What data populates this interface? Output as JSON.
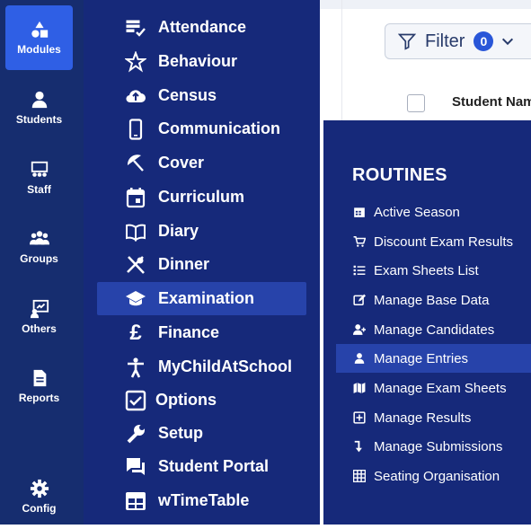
{
  "rail": {
    "items": [
      {
        "label": "Modules",
        "icon": "modules-icon"
      },
      {
        "label": "Students",
        "icon": "user-icon"
      },
      {
        "label": "Staff",
        "icon": "staff-icon"
      },
      {
        "label": "Groups",
        "icon": "groups-icon"
      },
      {
        "label": "Others",
        "icon": "others-icon"
      },
      {
        "label": "Reports",
        "icon": "report-icon"
      },
      {
        "label": "Config",
        "icon": "gear-icon"
      }
    ]
  },
  "menu": {
    "items": [
      {
        "label": "Attendance"
      },
      {
        "label": "Behaviour"
      },
      {
        "label": "Census"
      },
      {
        "label": "Communication"
      },
      {
        "label": "Cover"
      },
      {
        "label": "Curriculum"
      },
      {
        "label": "Diary"
      },
      {
        "label": "Dinner"
      },
      {
        "label": "Examination"
      },
      {
        "label": "Finance"
      },
      {
        "label": "MyChildAtSchool"
      },
      {
        "label": "Options"
      },
      {
        "label": "Setup"
      },
      {
        "label": "Student Portal"
      },
      {
        "label": "wTimeTable"
      }
    ]
  },
  "content": {
    "filter_label": "Filter",
    "filter_count": "0",
    "column_header": "Student Nam"
  },
  "popup": {
    "title": "ROUTINES",
    "items": [
      {
        "label": "Active Season"
      },
      {
        "label": "Discount Exam Results"
      },
      {
        "label": "Exam Sheets List"
      },
      {
        "label": "Manage Base Data"
      },
      {
        "label": "Manage Candidates"
      },
      {
        "label": "Manage Entries"
      },
      {
        "label": "Manage Exam Sheets"
      },
      {
        "label": "Manage Results"
      },
      {
        "label": "Manage Submissions"
      },
      {
        "label": "Seating Organisation"
      }
    ]
  },
  "colors": {
    "rail_bg": "#162d6f",
    "menu_bg": "#16297a",
    "active_bg": "#2743aa",
    "accent": "#2f5fe5"
  }
}
